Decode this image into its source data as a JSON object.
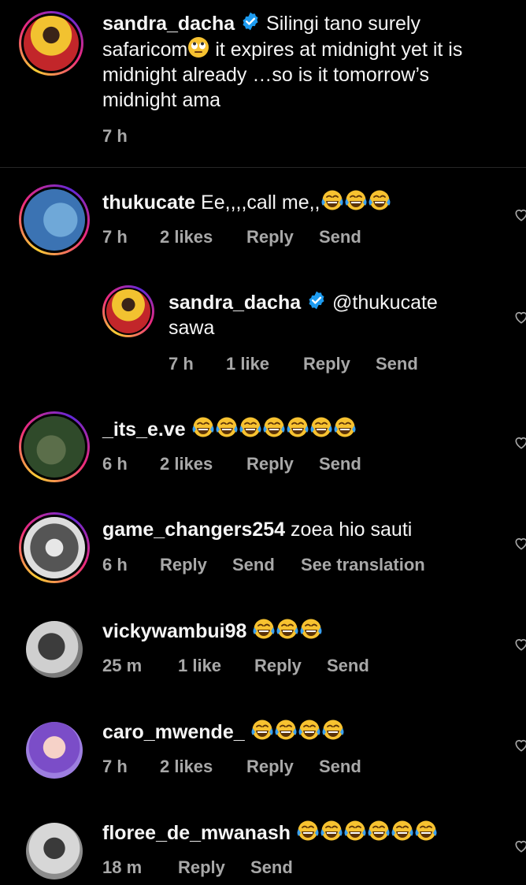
{
  "caption": {
    "username": "sandra_dacha",
    "text_a": "Silingi tano surely",
    "text_b": "safaricom",
    "text_c": "it expires at midnight yet it is midnight already …so is it tomorrow’s midnight ama",
    "time": "7 h"
  },
  "comments": [
    {
      "username": "thukucate",
      "text": "Ee,,,,call me,,",
      "time": "7 h",
      "likes": "2 likes",
      "reply": "Reply",
      "send": "Send"
    },
    {
      "username": "sandra_dacha",
      "mention": "@thukucate",
      "text": "sawa",
      "time": "7 h",
      "likes": "1 like",
      "reply": "Reply",
      "send": "Send"
    },
    {
      "username": "_its_e.ve",
      "time": "6 h",
      "likes": "2 likes",
      "reply": "Reply",
      "send": "Send"
    },
    {
      "username": "game_changers254",
      "text": "zoea hio sauti",
      "time": "6 h",
      "reply": "Reply",
      "send": "Send",
      "translate": "See translation"
    },
    {
      "username": "vickywambui98",
      "time": "25 m",
      "likes": "1 like",
      "reply": "Reply",
      "send": "Send"
    },
    {
      "username": "caro_mwende_",
      "time": "7 h",
      "likes": "2 likes",
      "reply": "Reply",
      "send": "Send"
    },
    {
      "username": "floree_de_mwanash",
      "time": "18 m",
      "reply": "Reply",
      "send": "Send"
    }
  ],
  "icons": {
    "verified": "verified-badge-icon",
    "like": "heart-outline-icon",
    "laugh": "face-with-tears-of-joy-emoji",
    "eyeroll": "face-with-rolling-eyes-emoji"
  },
  "colors": {
    "verified": "#1d9bf0",
    "meta_text": "#a8a8a8",
    "background": "#000000"
  }
}
